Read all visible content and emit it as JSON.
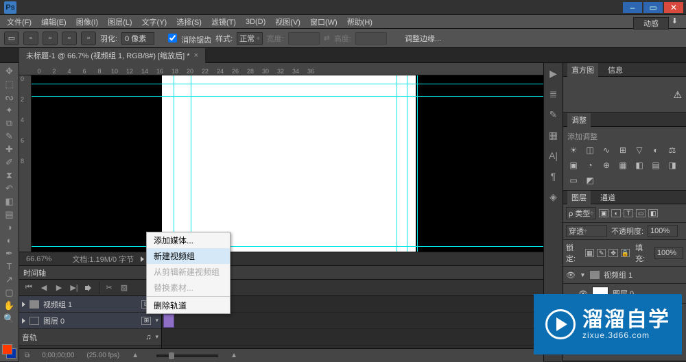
{
  "app": {
    "name": "Ps"
  },
  "menu": [
    "文件(F)",
    "编辑(E)",
    "图像(I)",
    "图层(L)",
    "文字(Y)",
    "选择(S)",
    "滤镜(T)",
    "3D(D)",
    "视图(V)",
    "窗口(W)",
    "帮助(H)"
  ],
  "options_bar": {
    "feather_label": "羽化:",
    "feather_value": "0 像素",
    "anti_alias_label": "消除锯齿",
    "style_label": "样式:",
    "style_value": "正常",
    "width_label": "宽度:",
    "height_label": "高度:",
    "refine_edge": "调整边缘...",
    "workspace": "动感"
  },
  "doc_tab": {
    "title": "未标题-1 @ 66.7% (视频组 1, RGB/8#) [缩放后] *"
  },
  "status": {
    "zoom": "66.67%",
    "doc_info": "文档:1.19M/0 字节"
  },
  "ruler_h": [
    "0",
    "2",
    "4",
    "6",
    "8",
    "10",
    "12",
    "14",
    "16",
    "18",
    "20",
    "22",
    "24",
    "26",
    "28",
    "30",
    "32",
    "34",
    "36"
  ],
  "ruler_v": [
    "0",
    "2",
    "4",
    "6",
    "8"
  ],
  "context_menu": {
    "add_media": "添加媒体...",
    "new_video_group": "新建视频组",
    "new_from_clips": "从剪辑新建视频组",
    "replace_media": "替换素材...",
    "delete_track": "删除轨道"
  },
  "timeline": {
    "title": "时间轴",
    "track_video_group": "视频组 1",
    "track_layer": "图层 0",
    "track_audio": "音轨",
    "time_display": "0;00;00;00",
    "fps": "(25.00 fps)"
  },
  "panels": {
    "histogram_tab": "直方图",
    "info_tab": "信息",
    "adjustments_tab": "调整",
    "add_adj": "添加调整",
    "layers_tab": "图层",
    "channels_tab": "通道",
    "filter_label": "ρ 类型",
    "blend_mode": "穿透",
    "opacity_label": "不透明度:",
    "opacity_value": "100%",
    "lock_label": "锁定:",
    "fill_label": "填充:",
    "fill_value": "100%",
    "layer_group": "视频组 1",
    "layer_name": "图层 0"
  },
  "watermark": {
    "title": "溜溜自学",
    "url": "zixue.3d66.com"
  }
}
